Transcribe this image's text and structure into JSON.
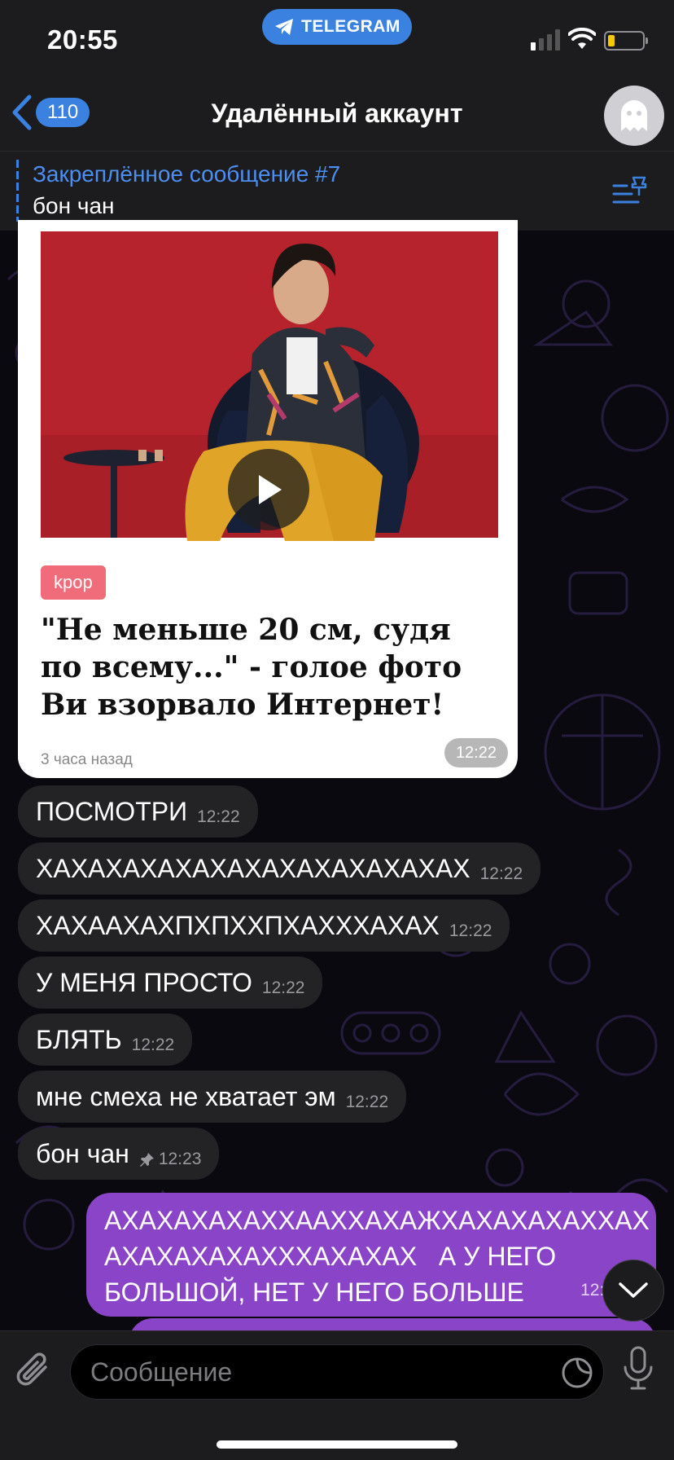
{
  "status_bar": {
    "time": "20:55",
    "app_pill": "TELEGRAM",
    "battery_level": 0.2,
    "battery_color": "#f5c800"
  },
  "header": {
    "back_badge": "110",
    "title": "Удалённый аккаунт",
    "avatar_icon": "ghost-icon"
  },
  "pinned": {
    "title": "Закреплённое сообщение #7",
    "text": "бон чан"
  },
  "link_card": {
    "tag": "kpop",
    "headline": "\"Не меньше 20 см, судя по всему...\" - голое фото Ви взорвало Интернет!",
    "posted": "3 часа назад",
    "time": "12:22"
  },
  "messages": [
    {
      "text": "ПОСМОТРИ",
      "time": "12:22"
    },
    {
      "text": "ХАХАХАХАХАХАХАХАХАХАХАХАХ",
      "time": "12:22"
    },
    {
      "text": "ХАХААХАХПХПХХПХАХХХАХАХ",
      "time": "12:22"
    },
    {
      "text": "У МЕНЯ ПРОСТО",
      "time": "12:22"
    },
    {
      "text": "БЛЯТЬ",
      "time": "12:22"
    },
    {
      "text": "мне смеха не хватает эм",
      "time": "12:22"
    },
    {
      "text": "бон чан",
      "time": "12:23",
      "pinned": true
    }
  ],
  "outgoing": {
    "lines": [
      "АХАХАХАХАХХААХХАХАЖХАХАХАХАХХАХ",
      "АХАХАХАХАХХХАХАХАХ   А У НЕГО",
      "БОЛЬШОЙ, НЕТ У НЕГО БОЛЬШЕ"
    ],
    "time": "12:2"
  },
  "input": {
    "placeholder": "Сообщение"
  },
  "colors": {
    "accent": "#3b82e0",
    "outgoing_bubble": "#8a44c8",
    "incoming_bubble": "#232325"
  }
}
